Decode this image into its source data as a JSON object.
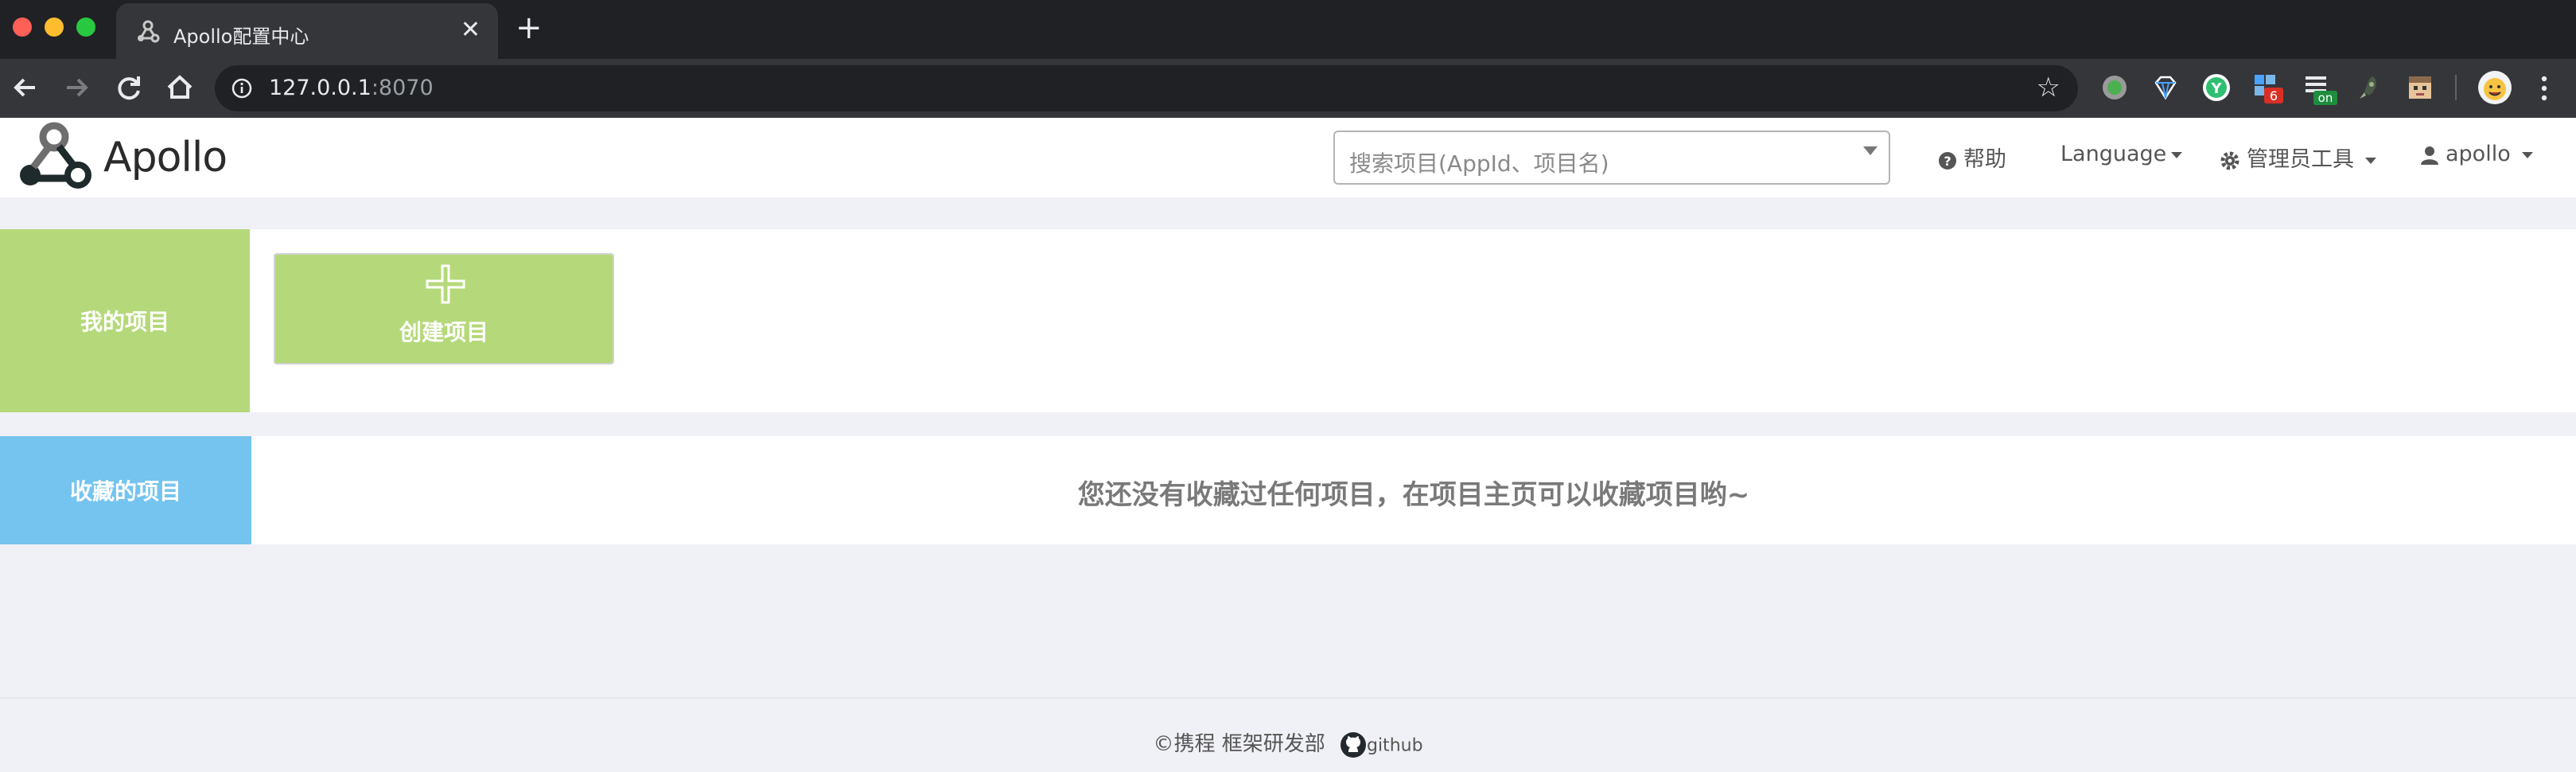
{
  "browser": {
    "tab_title": "Apollo配置中心",
    "url_host": "127.0.0.1",
    "url_port": ":8070",
    "extensions": [
      {
        "name": "ext-green-dot-icon",
        "color": "#7a8a7a"
      },
      {
        "name": "ext-diamond-icon",
        "color": "#ffffff"
      },
      {
        "name": "ext-y-icon",
        "color": "#2fbf71"
      },
      {
        "name": "ext-badge-6-icon",
        "badge": "6"
      },
      {
        "name": "ext-badge-on-icon",
        "badge": "on"
      },
      {
        "name": "ext-rocket-icon",
        "color": "#9bb38c"
      },
      {
        "name": "ext-face-icon",
        "color": "#d9b48a"
      }
    ]
  },
  "header": {
    "logo_text": "Apollo",
    "search_placeholder": "搜索项目(AppId、项目名)",
    "help_label": "帮助",
    "language_label": "Language",
    "admin_tools_label": "管理员工具",
    "user_label": "apollo"
  },
  "my_projects": {
    "label": "我的项目",
    "create_label": "创建项目"
  },
  "favorites": {
    "label": "收藏的项目",
    "empty_message": "您还没有收藏过任何项目，在项目主页可以收藏项目哟~"
  },
  "footer": {
    "copyright": "©携程 框架研发部",
    "github_label": "github"
  },
  "colors": {
    "my_projects_accent": "#b5d97a",
    "favorites_accent": "#75c4ef",
    "page_background": "#f0f1f6"
  }
}
